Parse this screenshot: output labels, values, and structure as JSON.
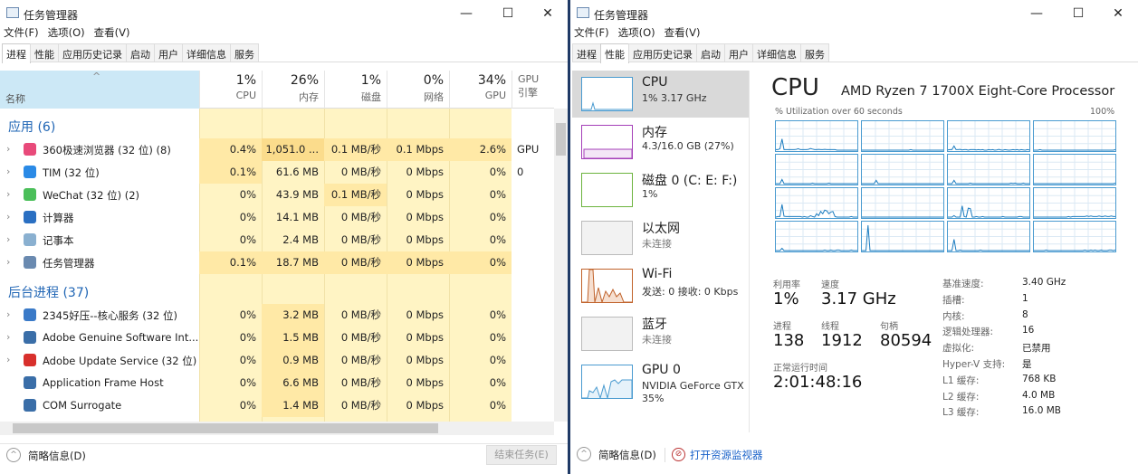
{
  "left": {
    "title": "任务管理器",
    "menu": [
      "文件(F)",
      "选项(O)",
      "查看(V)"
    ],
    "tabs": [
      "进程",
      "性能",
      "应用历史记录",
      "启动",
      "用户",
      "详细信息",
      "服务"
    ],
    "active_tab": 0,
    "columns": [
      {
        "pct": "1%",
        "label": "CPU"
      },
      {
        "pct": "26%",
        "label": "内存"
      },
      {
        "pct": "1%",
        "label": "磁盘"
      },
      {
        "pct": "0%",
        "label": "网络"
      },
      {
        "pct": "34%",
        "label": "GPU"
      },
      {
        "pct": "",
        "label": "GPU 引擎"
      }
    ],
    "name_header": "名称",
    "groups": [
      {
        "title": "应用 (6)",
        "rows": [
          {
            "name": "360极速浏览器 (32 位) (8)",
            "icon_color": "#e84a7a",
            "expand": true,
            "cells": [
              "0.4%",
              "1,051.0 ...",
              "0.1 MB/秒",
              "0.1 Mbps",
              "2.6%",
              "GPU 0"
            ],
            "heat": [
              1,
              2,
              1,
              1,
              1,
              0
            ]
          },
          {
            "name": "TIM (32 位)",
            "icon_color": "#2a8ae6",
            "expand": true,
            "cells": [
              "0.1%",
              "61.6 MB",
              "0 MB/秒",
              "0 Mbps",
              "0%",
              ""
            ],
            "heat": [
              1,
              0,
              0,
              0,
              0,
              0
            ]
          },
          {
            "name": "WeChat (32 位) (2)",
            "icon_color": "#4bbf5a",
            "expand": true,
            "cells": [
              "0%",
              "43.9 MB",
              "0.1 MB/秒",
              "0 Mbps",
              "0%",
              ""
            ],
            "heat": [
              0,
              0,
              1,
              0,
              0,
              0
            ]
          },
          {
            "name": "计算器",
            "icon_color": "#2a6fc2",
            "expand": true,
            "cells": [
              "0%",
              "14.1 MB",
              "0 MB/秒",
              "0 Mbps",
              "0%",
              ""
            ],
            "heat": [
              0,
              0,
              0,
              0,
              0,
              0
            ]
          },
          {
            "name": "记事本",
            "icon_color": "#8ab0d0",
            "expand": true,
            "cells": [
              "0%",
              "2.4 MB",
              "0 MB/秒",
              "0 Mbps",
              "0%",
              ""
            ],
            "heat": [
              0,
              0,
              0,
              0,
              0,
              0
            ]
          },
          {
            "name": "任务管理器",
            "icon_color": "#6a8ab0",
            "expand": true,
            "cells": [
              "0.1%",
              "18.7 MB",
              "0 MB/秒",
              "0 Mbps",
              "0%",
              ""
            ],
            "heat": [
              1,
              1,
              1,
              1,
              1,
              0
            ]
          }
        ]
      },
      {
        "title": "后台进程 (37)",
        "rows": [
          {
            "name": "2345好压--核心服务 (32 位)",
            "icon_color": "#3a7ac8",
            "expand": true,
            "cells": [
              "0%",
              "3.2 MB",
              "0 MB/秒",
              "0 Mbps",
              "0%",
              ""
            ],
            "heat": [
              0,
              1,
              0,
              0,
              0,
              0
            ]
          },
          {
            "name": "Adobe Genuine Software Int...",
            "icon_color": "#3a6ea8",
            "expand": true,
            "cells": [
              "0%",
              "1.5 MB",
              "0 MB/秒",
              "0 Mbps",
              "0%",
              ""
            ],
            "heat": [
              0,
              1,
              0,
              0,
              0,
              0
            ]
          },
          {
            "name": "Adobe Update Service (32 位)",
            "icon_color": "#d8302c",
            "expand": true,
            "cells": [
              "0%",
              "0.9 MB",
              "0 MB/秒",
              "0 Mbps",
              "0%",
              ""
            ],
            "heat": [
              0,
              1,
              0,
              0,
              0,
              0
            ]
          },
          {
            "name": "Application Frame Host",
            "icon_color": "#3a6ea8",
            "expand": false,
            "cells": [
              "0%",
              "6.6 MB",
              "0 MB/秒",
              "0 Mbps",
              "0%",
              ""
            ],
            "heat": [
              0,
              1,
              0,
              0,
              0,
              0
            ]
          },
          {
            "name": "COM Surrogate",
            "icon_color": "#3a6ea8",
            "expand": false,
            "cells": [
              "0%",
              "1.4 MB",
              "0 MB/秒",
              "0 Mbps",
              "0%",
              ""
            ],
            "heat": [
              0,
              1,
              0,
              0,
              0,
              0
            ]
          }
        ]
      }
    ],
    "footer_label": "简略信息(D)",
    "end_task": "结束任务(E)"
  },
  "right": {
    "title": "任务管理器",
    "menu": [
      "文件(F)",
      "选项(O)",
      "查看(V)"
    ],
    "tabs": [
      "进程",
      "性能",
      "应用历史记录",
      "启动",
      "用户",
      "详细信息",
      "服务"
    ],
    "active_tab": 1,
    "sidebar": [
      {
        "title": "CPU",
        "sub": "1% 3.17 GHz",
        "color": "#4a9bd0",
        "selected": true,
        "gray": false
      },
      {
        "title": "内存",
        "sub": "4.3/16.0 GB (27%)",
        "color": "#a43fb8",
        "selected": false,
        "gray": false
      },
      {
        "title": "磁盘 0 (C: E: F:)",
        "sub": "1%",
        "color": "#6cb33e",
        "selected": false,
        "gray": false
      },
      {
        "title": "以太网",
        "sub": "未连接",
        "color": "#bbbbbb",
        "selected": false,
        "gray": true
      },
      {
        "title": "Wi-Fi",
        "sub": "发送: 0 接收: 0 Kbps",
        "color": "#c0622a",
        "selected": false,
        "gray": false
      },
      {
        "title": "蓝牙",
        "sub": "未连接",
        "color": "#bbbbbb",
        "selected": false,
        "gray": true
      },
      {
        "title": "GPU 0",
        "sub": "NVIDIA GeForce GTX",
        "sub2": "35%",
        "color": "#4a9bd0",
        "selected": false,
        "gray": false
      }
    ],
    "heading": "CPU",
    "processor": "AMD Ryzen 7 1700X Eight-Core Processor",
    "util_label": "% Utilization over 60 seconds",
    "util_max": "100%",
    "core_series": [
      [
        0,
        0,
        0,
        0,
        0,
        0,
        0,
        0,
        0,
        0,
        0,
        2,
        2,
        2,
        2,
        2,
        3,
        2,
        2,
        3,
        2,
        2,
        4,
        6,
        3,
        2,
        2,
        2,
        2,
        5,
        3,
        2,
        2,
        2,
        2,
        2,
        2,
        40,
        5,
        2,
        2
      ],
      [
        0,
        0,
        0,
        0,
        0,
        0,
        0,
        0,
        0,
        0,
        0,
        0,
        0,
        0,
        0,
        0,
        2,
        0,
        0,
        0,
        0,
        0,
        0,
        0,
        0,
        0,
        0,
        0,
        0,
        0,
        0,
        0,
        0,
        0,
        0,
        0,
        0,
        0,
        0,
        0,
        0
      ],
      [
        1,
        2,
        0,
        1,
        2,
        0,
        2,
        1,
        2,
        1,
        0,
        1,
        2,
        0,
        1,
        3,
        1,
        0,
        2,
        1,
        2,
        0,
        0,
        2,
        1,
        2,
        1,
        2,
        2,
        2,
        0,
        2,
        2,
        1,
        3,
        2,
        2,
        15,
        2,
        2,
        1
      ],
      [
        2,
        0,
        0,
        0,
        0,
        0,
        0,
        0,
        0,
        0,
        0,
        0,
        0,
        0,
        0,
        0,
        0,
        0,
        0,
        0,
        0,
        0,
        0,
        0,
        0,
        0,
        0,
        0,
        0,
        0,
        0,
        0,
        0,
        0,
        0,
        0,
        0,
        2,
        0,
        0,
        0
      ],
      [
        0,
        0,
        0,
        0,
        0,
        0,
        0,
        0,
        0,
        0,
        0,
        0,
        0,
        0,
        2,
        0,
        0,
        0,
        0,
        0,
        0,
        0,
        2,
        0,
        0,
        0,
        0,
        0,
        0,
        0,
        0,
        0,
        0,
        0,
        0,
        0,
        0,
        15,
        0,
        0,
        0
      ],
      [
        0,
        0,
        0,
        0,
        0,
        0,
        0,
        0,
        0,
        0,
        0,
        0,
        0,
        0,
        0,
        0,
        0,
        0,
        0,
        0,
        0,
        0,
        0,
        0,
        0,
        0,
        0,
        0,
        0,
        0,
        0,
        0,
        0,
        12,
        0,
        0,
        0,
        0,
        0,
        0,
        0
      ],
      [
        0,
        0,
        0,
        2,
        0,
        0,
        0,
        2,
        1,
        2,
        0,
        0,
        0,
        0,
        0,
        0,
        0,
        0,
        0,
        0,
        0,
        0,
        0,
        0,
        0,
        0,
        0,
        0,
        0,
        2,
        0,
        0,
        0,
        0,
        0,
        0,
        0,
        12,
        0,
        0,
        0
      ],
      [
        2,
        0,
        0,
        0,
        0,
        0,
        0,
        0,
        0,
        0,
        0,
        0,
        0,
        0,
        0,
        0,
        0,
        0,
        0,
        0,
        0,
        0,
        0,
        0,
        0,
        0,
        0,
        0,
        0,
        0,
        0,
        0,
        0,
        0,
        0,
        0,
        0,
        0,
        0,
        0,
        0
      ],
      [
        0,
        0,
        0,
        2,
        0,
        0,
        0,
        0,
        0,
        0,
        0,
        2,
        20,
        18,
        12,
        22,
        25,
        12,
        20,
        5,
        12,
        0,
        2,
        5,
        0,
        0,
        2,
        0,
        2,
        2,
        2,
        2,
        2,
        2,
        2,
        2,
        3,
        45,
        2,
        2,
        0
      ],
      [
        0,
        0,
        0,
        0,
        0,
        0,
        0,
        0,
        0,
        0,
        0,
        0,
        0,
        0,
        0,
        0,
        0,
        0,
        0,
        0,
        0,
        0,
        0,
        0,
        0,
        0,
        0,
        0,
        0,
        0,
        0,
        0,
        0,
        0,
        0,
        0,
        0,
        0,
        0,
        0,
        0
      ],
      [
        0,
        0,
        0,
        0,
        2,
        2,
        0,
        0,
        0,
        0,
        0,
        0,
        0,
        2,
        0,
        0,
        0,
        0,
        0,
        0,
        0,
        0,
        0,
        2,
        0,
        0,
        2,
        0,
        0,
        30,
        32,
        0,
        2,
        40,
        0,
        0,
        0,
        5,
        0,
        0,
        0
      ],
      [
        2,
        2,
        4,
        2,
        2,
        4,
        2,
        2,
        4,
        2,
        2,
        2,
        4,
        2,
        4,
        2,
        2,
        2,
        2,
        2,
        2,
        2,
        0,
        2,
        0,
        0,
        0,
        0,
        0,
        0,
        0,
        0,
        0,
        0,
        0,
        0,
        0,
        0,
        0,
        0,
        0
      ],
      [
        0,
        0,
        0,
        2,
        0,
        0,
        0,
        0,
        0,
        2,
        2,
        0,
        0,
        2,
        0,
        0,
        2,
        0,
        0,
        0,
        0,
        0,
        0,
        0,
        0,
        0,
        0,
        0,
        0,
        0,
        0,
        0,
        0,
        0,
        0,
        0,
        0,
        8,
        0,
        0,
        0
      ],
      [
        0,
        0,
        0,
        0,
        0,
        0,
        0,
        0,
        0,
        0,
        0,
        0,
        0,
        0,
        0,
        0,
        0,
        0,
        0,
        0,
        0,
        0,
        0,
        0,
        0,
        0,
        0,
        0,
        0,
        0,
        0,
        0,
        0,
        0,
        0,
        0,
        0,
        90,
        0,
        0,
        0
      ],
      [
        0,
        0,
        0,
        0,
        0,
        0,
        0,
        0,
        0,
        0,
        0,
        0,
        0,
        0,
        0,
        0,
        0,
        0,
        0,
        0,
        0,
        0,
        0,
        0,
        2,
        0,
        0,
        0,
        0,
        0,
        0,
        0,
        0,
        0,
        2,
        0,
        0,
        40,
        0,
        0,
        0
      ],
      [
        2,
        0,
        2,
        2,
        0,
        0,
        0,
        2,
        0,
        0,
        2,
        0,
        2,
        0,
        0,
        2,
        0,
        0,
        0,
        0,
        0,
        0,
        0,
        0,
        0,
        0,
        0,
        0,
        0,
        0,
        0,
        0,
        0,
        0,
        2,
        0,
        0,
        0,
        0,
        0,
        0
      ]
    ],
    "stats": {
      "util_label": "利用率",
      "util": "1%",
      "speed_label": "速度",
      "speed": "3.17 GHz",
      "proc_label": "进程",
      "proc": "138",
      "thread_label": "线程",
      "thread": "1912",
      "handle_label": "句柄",
      "handle": "80594",
      "uptime_label": "正常运行时间",
      "uptime": "2:01:48:16"
    },
    "specs": [
      {
        "k": "基准速度:",
        "v": "3.40 GHz"
      },
      {
        "k": "插槽:",
        "v": "1"
      },
      {
        "k": "内核:",
        "v": "8"
      },
      {
        "k": "逻辑处理器:",
        "v": "16"
      },
      {
        "k": "虚拟化:",
        "v": "已禁用"
      },
      {
        "k": "Hyper-V 支持:",
        "v": "是"
      },
      {
        "k": "L1 缓存:",
        "v": "768 KB"
      },
      {
        "k": "L2 缓存:",
        "v": "4.0 MB"
      },
      {
        "k": "L3 缓存:",
        "v": "16.0 MB"
      }
    ],
    "footer_label": "简略信息(D)",
    "resmon_link": "打开资源监视器"
  },
  "window_buttons": {
    "minimize": "—",
    "maximize": "☐",
    "close": "✕"
  }
}
